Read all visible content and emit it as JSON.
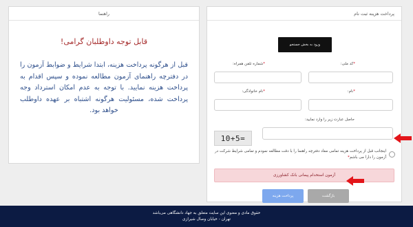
{
  "guide": {
    "header": "راهنما",
    "title": "قابل توجه داوطلبان گرامی!",
    "text": "قبل از هرگونه پرداخت هزینه، ابتدا شرایط و ضوابط آزمون را در دفترچه راهنمای آزمون مطالعه نموده و سپس اقدام به پرداخت هزینه نمایید. با توجه به عدم امکان استرداد وجه پرداخت شده، مسئولیت هرگونه اشتباه بر عهده داوطلب خواهد بود."
  },
  "form": {
    "header": "پرداخت هزینه ثبت نام",
    "search_button": "ورود به بخش جستجو",
    "national_code_label": "کد ملی:",
    "mobile_label": "شماره تلفن همراه:",
    "first_name_label": "نام:",
    "last_name_label": "نام خانوادگی:",
    "captcha_label": "حاصل عبارت زیر را وارد نمایید:",
    "captcha_text": "10+5=",
    "agreement": "اینجانب قبل از پرداخت هزینه تمامی مفاد دفترچه راهنما را با دقت مطالعه نمودم و تمامی شرایط شرکت در آزمون را دارا می باشم",
    "required_mark": "*",
    "alert": "آزمون استخدام پیمانی بانک کشاورزی",
    "pay_button": "پرداخت هزینه",
    "back_button": "بازگشت"
  },
  "footer": {
    "line1": "حقوق مادی و معنوی این سایت متعلق به جهاد دانشگاهی می‌باشد",
    "line2": "تهران - خیابان وصال شیرازی"
  },
  "colors": {
    "arrow": "#e3151a",
    "footer_bg": "#0c1b43",
    "guide_title": "#a52a2a",
    "guide_text": "#2c4d8a"
  }
}
